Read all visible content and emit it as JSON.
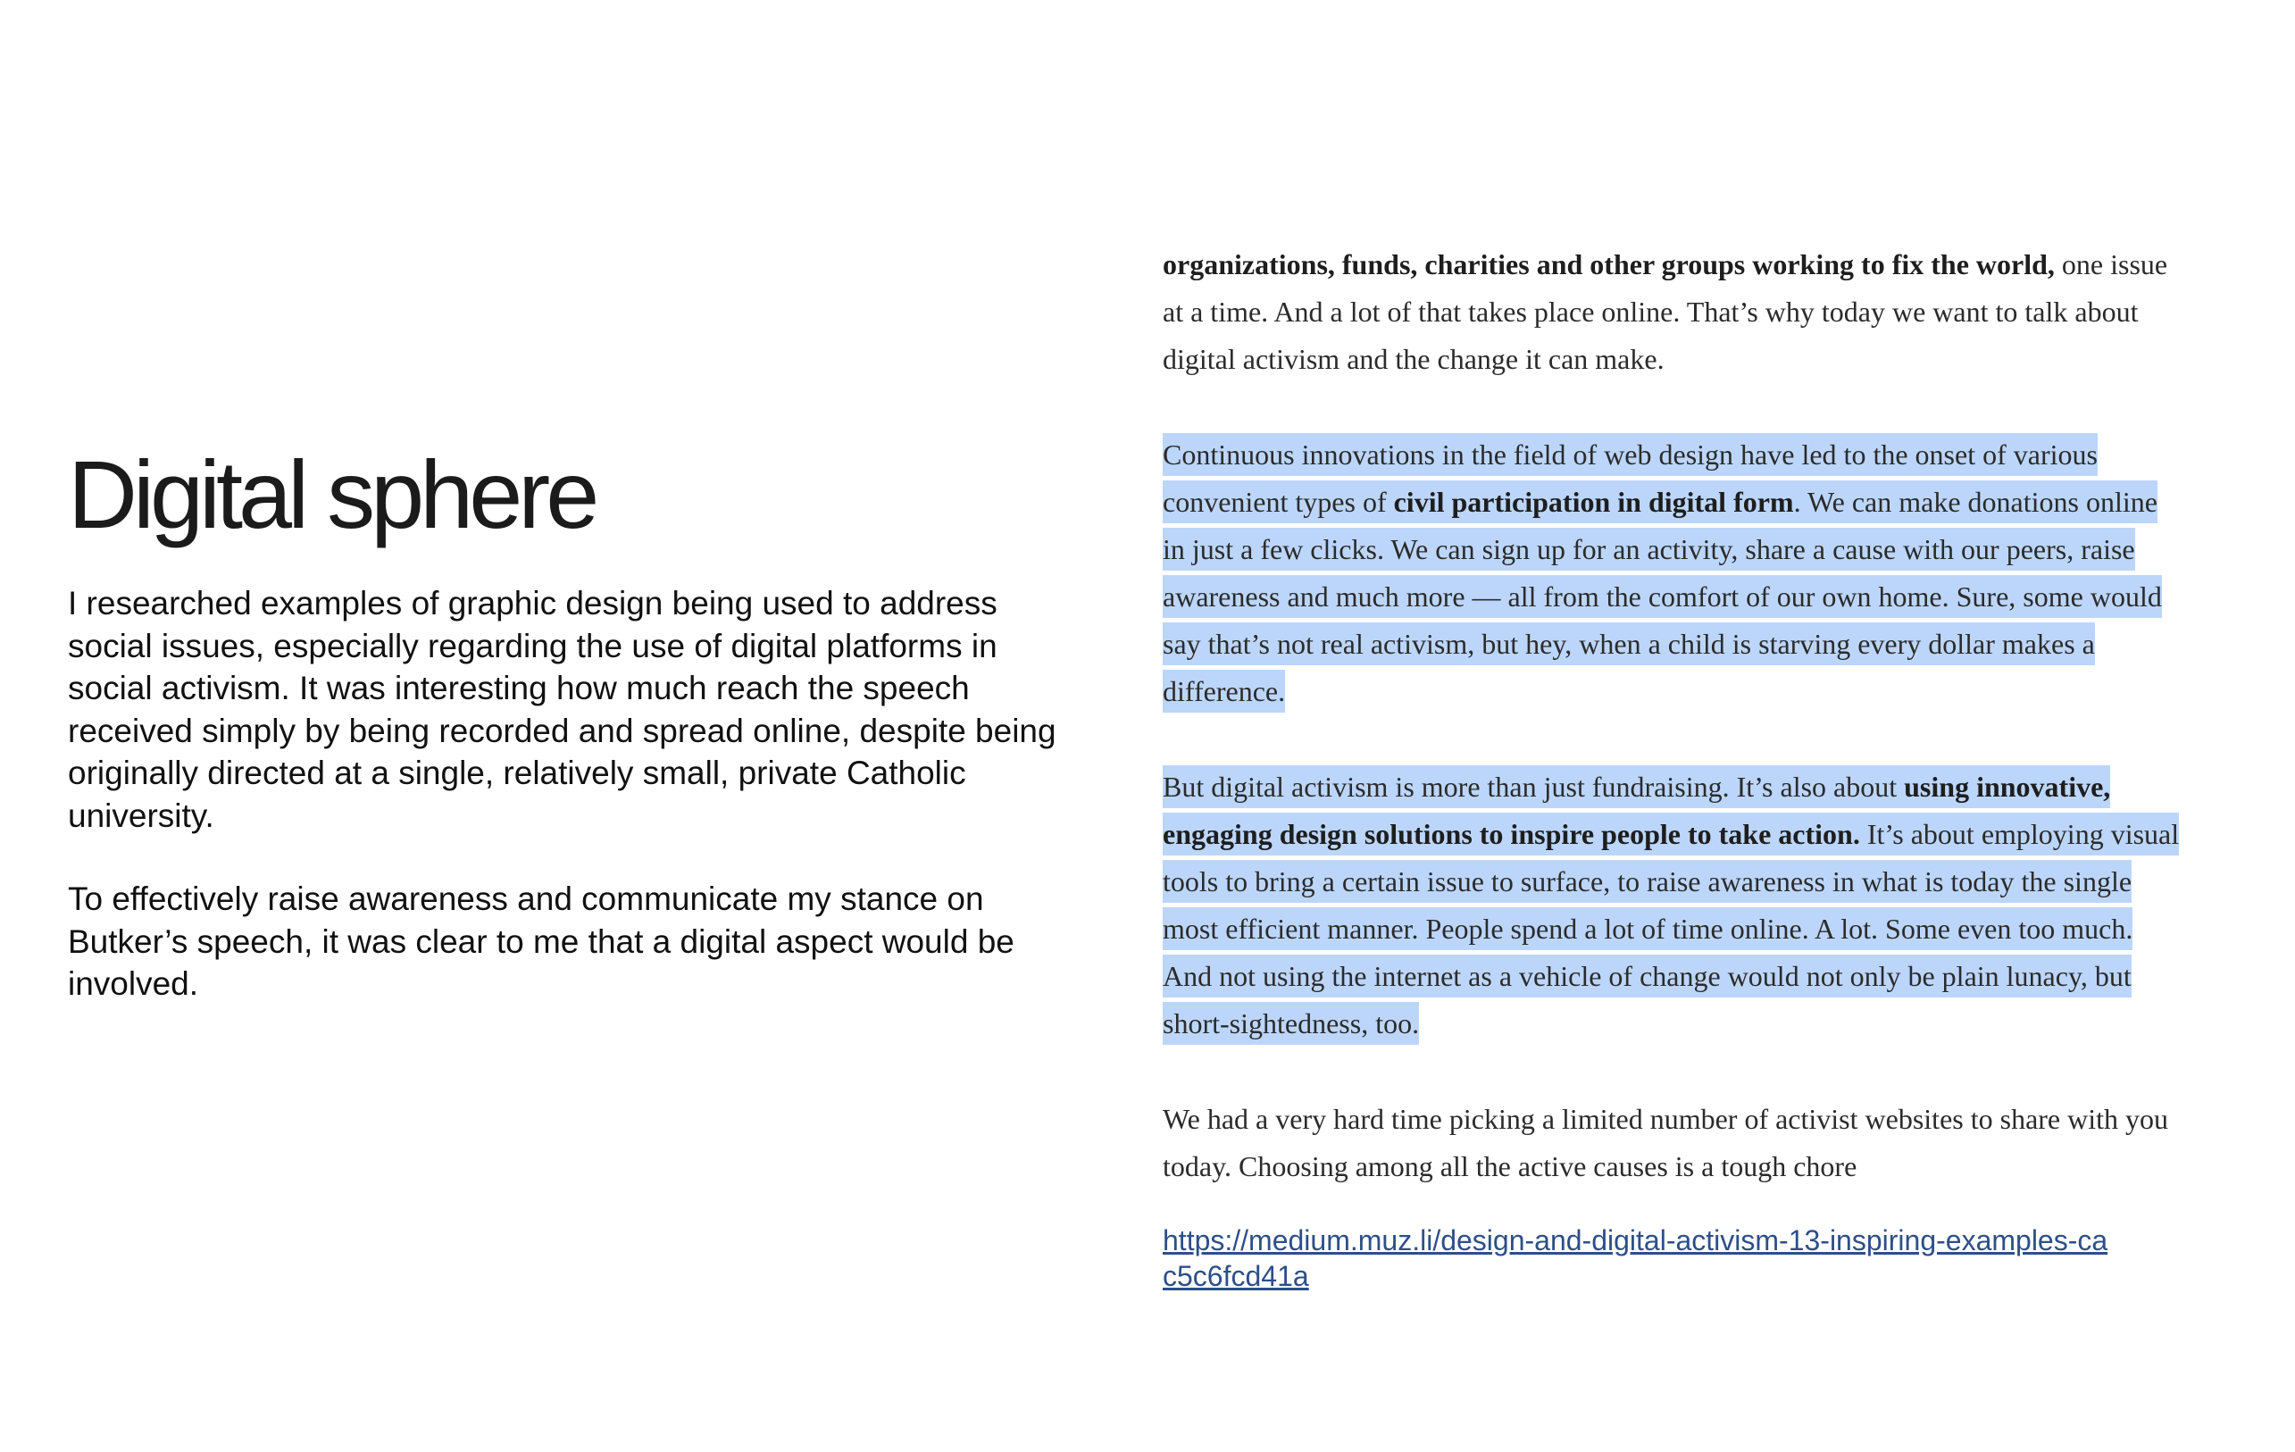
{
  "left": {
    "title": "Digital sphere",
    "paragraphs": [
      "I researched examples of graphic design being used to address social issues, especially regarding the use of digital platforms in social activism. It was interesting how much reach the speech received simply by being recorded and spread online, despite being originally directed at a single, relatively small, private Catholic university.",
      "To effectively raise awareness and communicate my stance on Butker’s speech, it was clear to me that a digital aspect would be involved."
    ]
  },
  "article": {
    "p1": {
      "bold": "organizations, funds, charities and other groups working to fix the world,",
      "rest": " one issue at a time. And a lot of that takes place online. That’s why today we want to talk about digital activism and the change it can make."
    },
    "p2": {
      "before": "Continuous innovations in the field of web design have led to the onset of various convenient types of ",
      "bold": "civil participation in digital form",
      "after": ". We can make donations online in just a few clicks. We can sign up for an activity, share a cause with our peers, raise awareness and much more — all from the comfort of our own home. Sure, some would say that’s not real activism, but hey, when a child is starving every dollar makes a difference."
    },
    "p3": {
      "before": "But digital activism is more than just fundraising. It’s also about ",
      "bold": "using innovative, engaging design solutions to inspire people to take action.",
      "after": " It’s about employing visual tools to bring a certain issue to surface, to raise awareness in what is today the single most efficient manner. People spend a lot of time online. A lot. Some even too much. And not using the internet as a vehicle of change would not only be plain lunacy, but short-sightedness, too."
    },
    "p4": "We had a very hard time picking a limited number of activist websites to share with you today. Choosing among all the active causes is a tough chore",
    "link": "https://medium.muz.li/design-and-digital-activism-13-inspiring-examples-cac5c6fcd41a"
  },
  "colors": {
    "highlight": "#bcd6fb",
    "link": "#2d4f8a"
  }
}
